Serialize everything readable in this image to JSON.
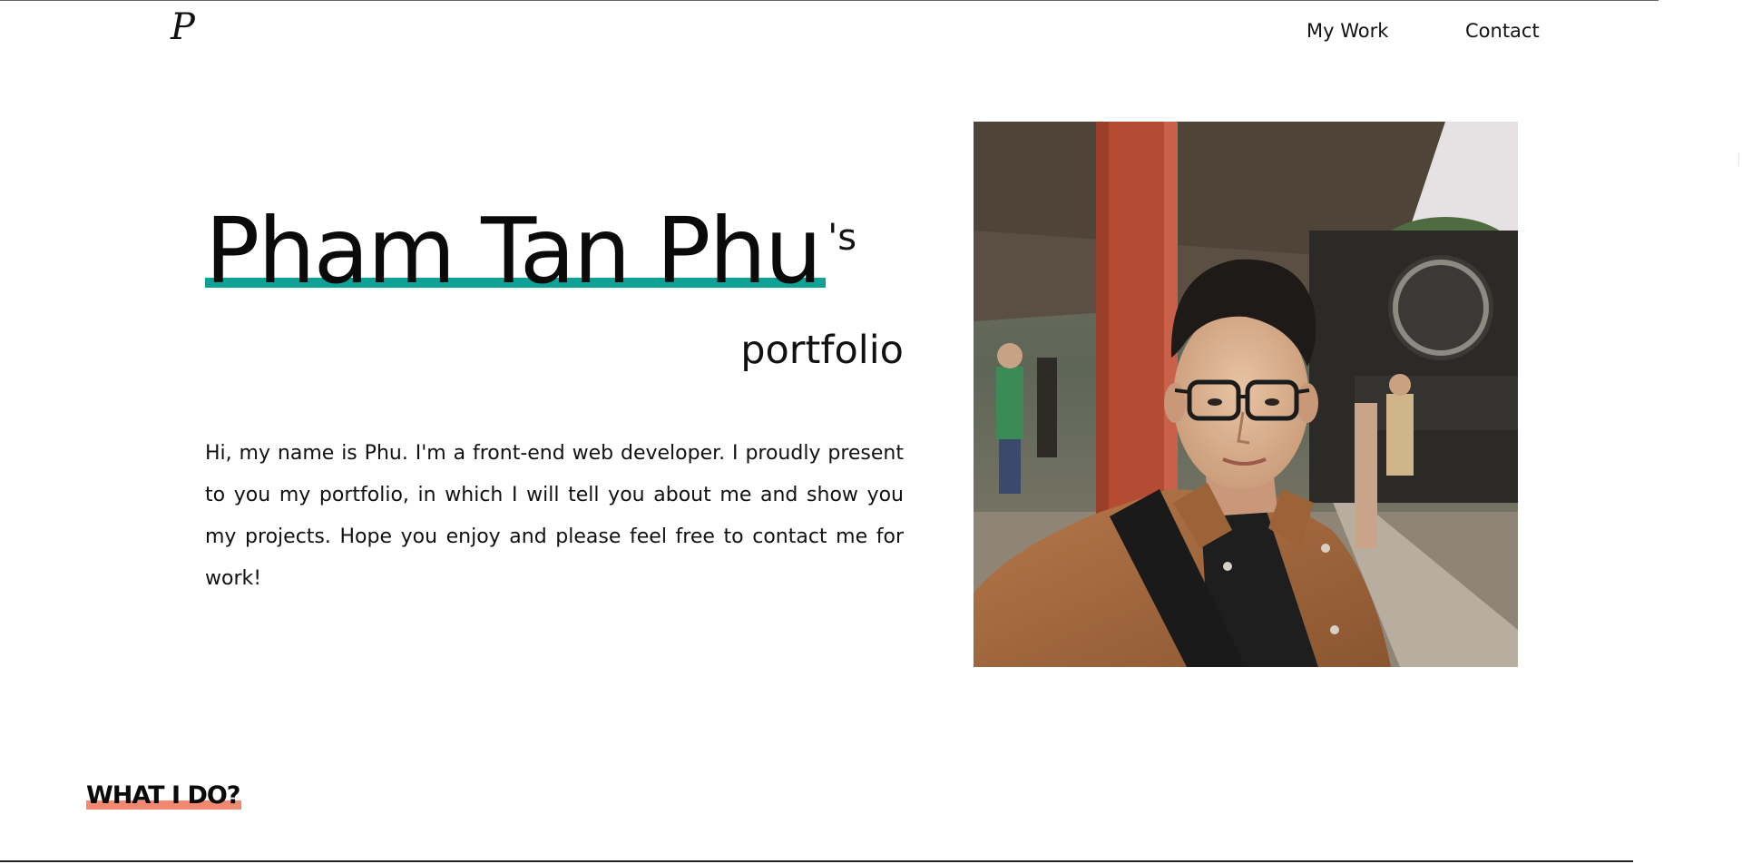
{
  "nav": {
    "logo": "P",
    "links": [
      {
        "label": "My Work"
      },
      {
        "label": "Contact"
      }
    ]
  },
  "hero": {
    "name": "Pham Tan Phu",
    "possessive": "'s",
    "subtitle": "portfolio",
    "intro": "Hi, my name is Phu. I'm a front-end web developer. I proudly present to you my portfolio, in which I will tell you about me and show you my projects. Hope you enjoy and please feel free to contact me for work!",
    "accent_color": "#0fa196"
  },
  "photo": {
    "icon": "portrait-photo"
  },
  "section": {
    "heading": "WHAT I DO?",
    "accent_color": "#f0896f"
  }
}
